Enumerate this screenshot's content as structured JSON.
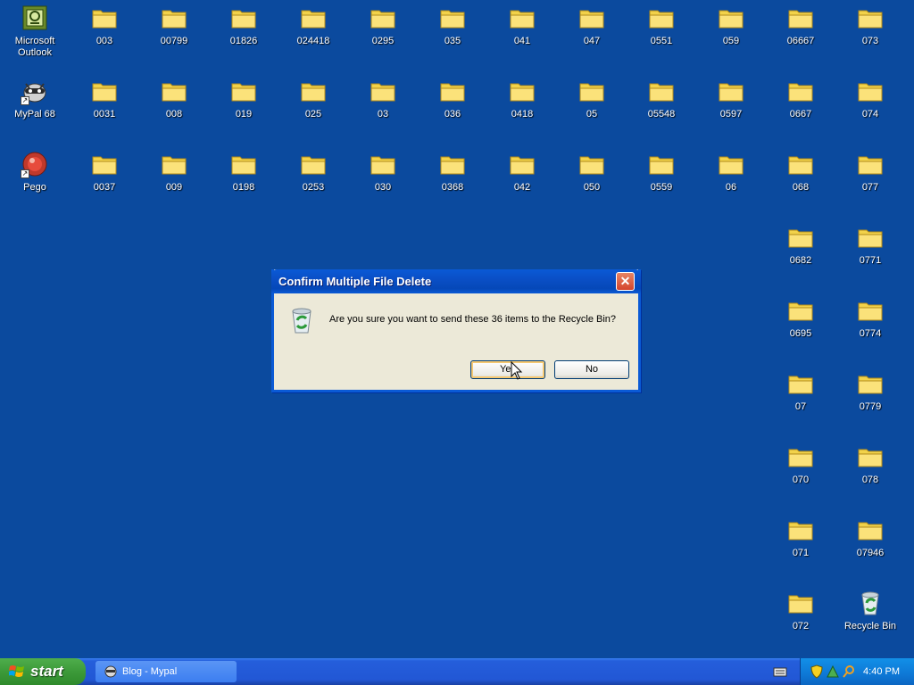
{
  "desktop_icons": [
    {
      "label": "Microsoft Outlook",
      "type": "outlook",
      "col": 0,
      "row": 0
    },
    {
      "label": "MyPal 68",
      "type": "mypal",
      "col": 0,
      "row": 1
    },
    {
      "label": "Pego",
      "type": "pego",
      "col": 0,
      "row": 2
    },
    {
      "label": "003",
      "type": "folder",
      "col": 1,
      "row": 0
    },
    {
      "label": "0031",
      "type": "folder",
      "col": 1,
      "row": 1
    },
    {
      "label": "0037",
      "type": "folder",
      "col": 1,
      "row": 2
    },
    {
      "label": "00799",
      "type": "folder",
      "col": 2,
      "row": 0
    },
    {
      "label": "008",
      "type": "folder",
      "col": 2,
      "row": 1
    },
    {
      "label": "009",
      "type": "folder",
      "col": 2,
      "row": 2
    },
    {
      "label": "01826",
      "type": "folder",
      "col": 3,
      "row": 0
    },
    {
      "label": "019",
      "type": "folder",
      "col": 3,
      "row": 1
    },
    {
      "label": "0198",
      "type": "folder",
      "col": 3,
      "row": 2
    },
    {
      "label": "024418",
      "type": "folder",
      "col": 4,
      "row": 0
    },
    {
      "label": "025",
      "type": "folder",
      "col": 4,
      "row": 1
    },
    {
      "label": "0253",
      "type": "folder",
      "col": 4,
      "row": 2
    },
    {
      "label": "0295",
      "type": "folder",
      "col": 5,
      "row": 0
    },
    {
      "label": "03",
      "type": "folder",
      "col": 5,
      "row": 1
    },
    {
      "label": "030",
      "type": "folder",
      "col": 5,
      "row": 2
    },
    {
      "label": "035",
      "type": "folder",
      "col": 6,
      "row": 0
    },
    {
      "label": "036",
      "type": "folder",
      "col": 6,
      "row": 1
    },
    {
      "label": "0368",
      "type": "folder",
      "col": 6,
      "row": 2
    },
    {
      "label": "041",
      "type": "folder",
      "col": 7,
      "row": 0
    },
    {
      "label": "0418",
      "type": "folder",
      "col": 7,
      "row": 1
    },
    {
      "label": "042",
      "type": "folder",
      "col": 7,
      "row": 2
    },
    {
      "label": "047",
      "type": "folder",
      "col": 8,
      "row": 0
    },
    {
      "label": "05",
      "type": "folder",
      "col": 8,
      "row": 1
    },
    {
      "label": "050",
      "type": "folder",
      "col": 8,
      "row": 2
    },
    {
      "label": "0551",
      "type": "folder",
      "col": 9,
      "row": 0
    },
    {
      "label": "05548",
      "type": "folder",
      "col": 9,
      "row": 1
    },
    {
      "label": "0559",
      "type": "folder",
      "col": 9,
      "row": 2
    },
    {
      "label": "059",
      "type": "folder",
      "col": 10,
      "row": 0
    },
    {
      "label": "0597",
      "type": "folder",
      "col": 10,
      "row": 1
    },
    {
      "label": "06",
      "type": "folder",
      "col": 10,
      "row": 2
    },
    {
      "label": "06667",
      "type": "folder",
      "col": 11,
      "row": 0
    },
    {
      "label": "0667",
      "type": "folder",
      "col": 11,
      "row": 1
    },
    {
      "label": "068",
      "type": "folder",
      "col": 11,
      "row": 2
    },
    {
      "label": "0682",
      "type": "folder",
      "col": 11,
      "row": 3
    },
    {
      "label": "0695",
      "type": "folder",
      "col": 11,
      "row": 4
    },
    {
      "label": "07",
      "type": "folder",
      "col": 11,
      "row": 5
    },
    {
      "label": "070",
      "type": "folder",
      "col": 11,
      "row": 6
    },
    {
      "label": "071",
      "type": "folder",
      "col": 11,
      "row": 7
    },
    {
      "label": "072",
      "type": "folder",
      "col": 11,
      "row": 8
    },
    {
      "label": "073",
      "type": "folder",
      "col": 12,
      "row": 0
    },
    {
      "label": "074",
      "type": "folder",
      "col": 12,
      "row": 1
    },
    {
      "label": "077",
      "type": "folder",
      "col": 12,
      "row": 2
    },
    {
      "label": "0771",
      "type": "folder",
      "col": 12,
      "row": 3
    },
    {
      "label": "0774",
      "type": "folder",
      "col": 12,
      "row": 4
    },
    {
      "label": "0779",
      "type": "folder",
      "col": 12,
      "row": 5
    },
    {
      "label": "078",
      "type": "folder",
      "col": 12,
      "row": 6
    },
    {
      "label": "07946",
      "type": "folder",
      "col": 12,
      "row": 7
    },
    {
      "label": "Recycle Bin",
      "type": "recycle",
      "col": 12,
      "row": 8
    }
  ],
  "dialog": {
    "title": "Confirm Multiple File Delete",
    "close_label": "✕",
    "message": "Are you sure you want to send these 36 items to the Recycle Bin?",
    "yes_label": "Yes",
    "no_label": "No"
  },
  "taskbar": {
    "start_label": "start",
    "task_label": "Blog - Mypal",
    "clock": "4:40 PM"
  },
  "colors": {
    "desktop": "#0b4a9e",
    "title_bar": "#0a5ad6",
    "dialog_face": "#ece9d8",
    "start_green": "#3c9a39",
    "taskbar_blue": "#245edb",
    "tray_blue": "#0e78d6"
  }
}
